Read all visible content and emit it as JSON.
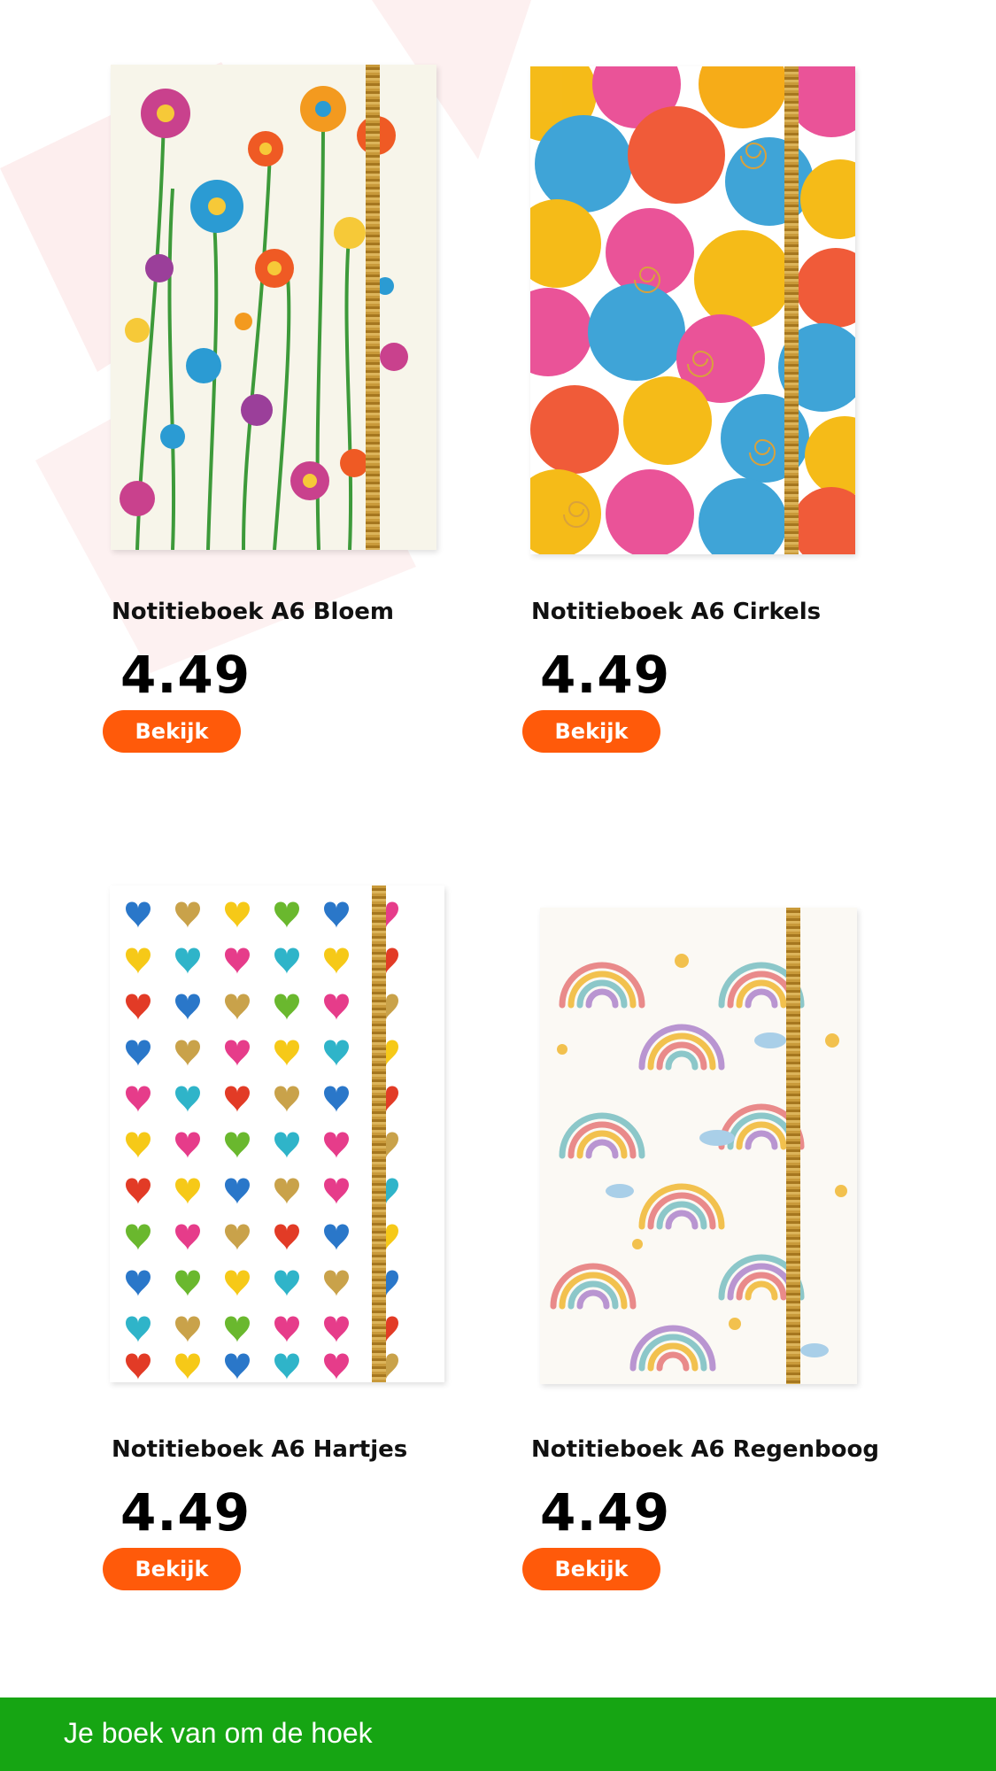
{
  "products": [
    {
      "title": "Notitieboek A6 Bloem",
      "price": "4.49",
      "button": "Bekijk",
      "cover": "flowers"
    },
    {
      "title": "Notitieboek A6 Cirkels",
      "price": "4.49",
      "button": "Bekijk",
      "cover": "circles"
    },
    {
      "title": "Notitieboek A6 Hartjes",
      "price": "4.49",
      "button": "Bekijk",
      "cover": "hearts"
    },
    {
      "title": "Notitieboek A6 Regenboog",
      "price": "4.49",
      "button": "Bekijk",
      "cover": "rainbows"
    }
  ],
  "footer": {
    "tagline": "Je boek van om de hoek"
  },
  "colors": {
    "accent": "#ff5a0a",
    "footer_bg": "#16a513",
    "watermark": "#fde9e9"
  }
}
